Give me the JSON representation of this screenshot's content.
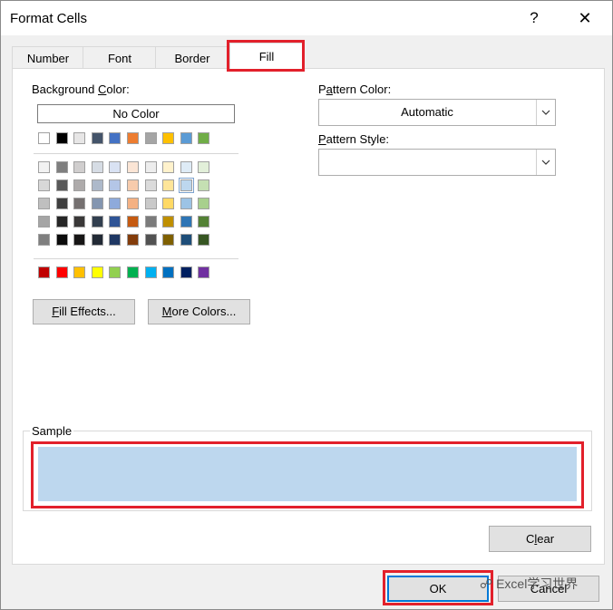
{
  "window": {
    "title": "Format Cells",
    "help_glyph": "?",
    "close_glyph": "✕"
  },
  "tabs": [
    {
      "label": "Number"
    },
    {
      "label": "Font"
    },
    {
      "label": "Border"
    },
    {
      "label": "Fill"
    }
  ],
  "active_tab": "Fill",
  "fill": {
    "background_color_label_pre": "Background ",
    "background_color_label_key": "C",
    "background_color_label_post": "olor:",
    "no_color_label": "No Color",
    "theme_top_row": [
      "#ffffff",
      "#000000",
      "#e7e6e6",
      "#44546a",
      "#4472c4",
      "#ed7d31",
      "#a5a5a5",
      "#ffc000",
      "#5b9bd5",
      "#70ad47"
    ],
    "theme_shades": [
      [
        "#f2f2f2",
        "#7f7f7f",
        "#d0cece",
        "#d6dce4",
        "#d9e2f3",
        "#fbe5d5",
        "#ededed",
        "#fff2cc",
        "#deebf6",
        "#e2efd9"
      ],
      [
        "#d8d8d8",
        "#595959",
        "#aeabab",
        "#adb9ca",
        "#b4c6e7",
        "#f7cbac",
        "#dbdbdb",
        "#fee599",
        "#bdd7ee",
        "#c5e0b3"
      ],
      [
        "#bfbfbf",
        "#3f3f3f",
        "#757070",
        "#8496b0",
        "#8eaadb",
        "#f4b183",
        "#c9c9c9",
        "#ffd965",
        "#9cc3e5",
        "#a8d08d"
      ],
      [
        "#a5a5a5",
        "#262626",
        "#3a3838",
        "#323f4f",
        "#2f5496",
        "#c55a11",
        "#7b7b7b",
        "#bf8f00",
        "#2e75b5",
        "#538135"
      ],
      [
        "#7f7f7f",
        "#0c0c0c",
        "#171616",
        "#222a35",
        "#1f3864",
        "#833c0b",
        "#525252",
        "#7f6000",
        "#1e4e79",
        "#375623"
      ]
    ],
    "selected_swatch": {
      "row": 1,
      "col": 8
    },
    "standard_colors": [
      "#c00000",
      "#ff0000",
      "#ffc000",
      "#ffff00",
      "#92d050",
      "#00b050",
      "#00b0f0",
      "#0070c0",
      "#002060",
      "#7030a0"
    ],
    "fill_effects_key": "F",
    "fill_effects_rest": "ill Effects...",
    "more_colors_key": "M",
    "more_colors_rest": "ore Colors...",
    "pattern_color_pre": "P",
    "pattern_color_key": "a",
    "pattern_color_post": "ttern Color:",
    "pattern_color_value": "Automatic",
    "pattern_style_key": "P",
    "pattern_style_rest": "attern Style:",
    "pattern_style_value": ""
  },
  "sample": {
    "label": "Sample",
    "color": "#bdd7ee"
  },
  "buttons": {
    "clear_pre": "C",
    "clear_key": "l",
    "clear_post": "ear",
    "ok": "OK",
    "cancel": "Cancel"
  },
  "watermark": "Excel学习世界",
  "colors": {
    "highlight": "#e2202b",
    "dialog_bg": "#f0f0f0"
  }
}
